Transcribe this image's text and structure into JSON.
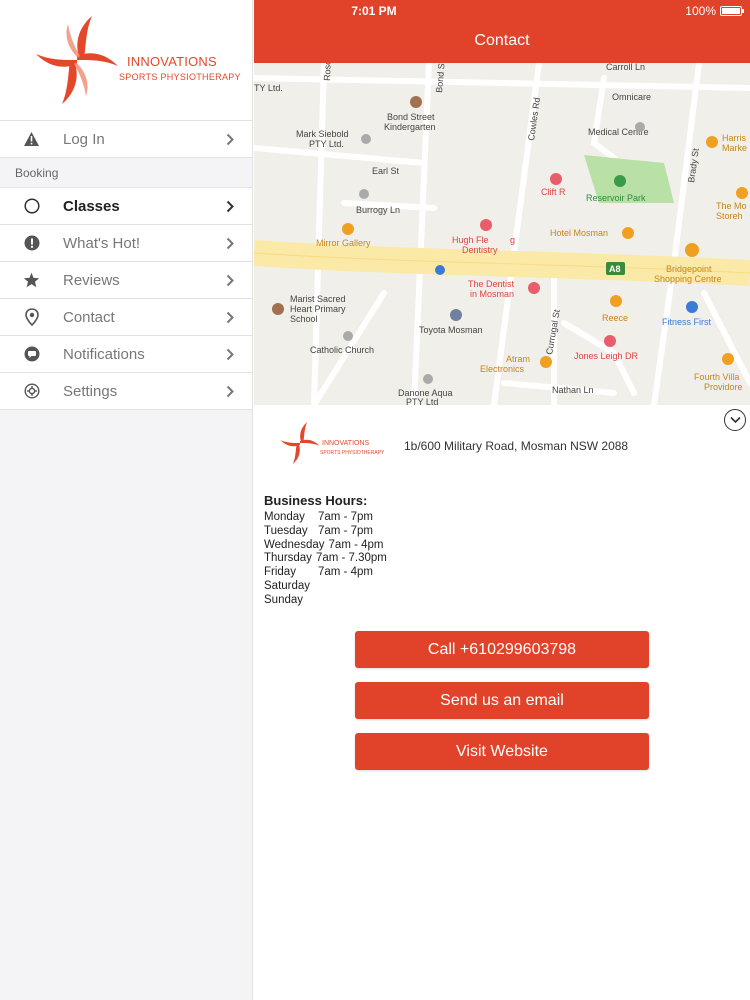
{
  "brand": {
    "name": "INNOVATIONS",
    "tagline": "SPORTS PHYSIOTHERAPY",
    "accent_color": "#e1432a"
  },
  "sidebar": {
    "items": [
      {
        "label": "Log In",
        "icon": "warning-icon"
      },
      {
        "label": "Classes",
        "icon": "circle-icon",
        "active": true
      },
      {
        "label": "What's Hot!",
        "icon": "exclamation-icon"
      },
      {
        "label": "Reviews",
        "icon": "star-icon"
      },
      {
        "label": "Contact",
        "icon": "location-pin-icon"
      },
      {
        "label": "Notifications",
        "icon": "chat-bubble-icon"
      },
      {
        "label": "Settings",
        "icon": "gear-icon"
      }
    ],
    "section_booking": "Booking"
  },
  "status": {
    "time": "7:01 PM",
    "battery": "100%"
  },
  "header": {
    "title": "Contact"
  },
  "map": {
    "labels": {
      "ptyltd": "TY Ltd.",
      "rose": "Rose",
      "bond": "Bond St",
      "bondkinder1": "Bond Street",
      "bondkinder2": "Kindergarten",
      "markseibold1": "Mark Siebold",
      "markseibold2": "PTY Ltd.",
      "cowles": "Cowles Rd",
      "omnicare1": "Omnicare",
      "omnicare2": "Medical Centre",
      "harris1": "Harris",
      "harris2": "Marke",
      "earl": "Earl St",
      "clift": "Clift R",
      "reservoir": "Reservoir Park",
      "brady": "Brady St",
      "themo1": "The Mo",
      "themo2": "Storeh",
      "burrogy": "Burrogy Ln",
      "hotel": "Hotel Mosman",
      "mirror": "Mirror Gallery",
      "hugh1": "Hugh Fle",
      "hugh2": "g",
      "hugh3": "Dentistry",
      "a8": "A8",
      "bridgepoint1": "Bridgepoint",
      "bridgepoint2": "Shopping Centre",
      "marist1": "Marist Sacred",
      "marist2": "Heart Primary",
      "marist3": "School",
      "dentist1": "The Dentist",
      "dentist2": "in Mosman",
      "reece": "Reece",
      "fitness": "Fitness First",
      "toyota": "Toyota Mosman",
      "currugal": "Currugal St",
      "catholic": "Catholic Church",
      "atram1": "Atram",
      "atram2": "Electronics",
      "jones": "Jones Leigh DR",
      "fourth1": "Fourth Villa",
      "fourth2": "Providore",
      "danone1": "Danone Aqua",
      "danone2": "PTY Ltd",
      "nathan": "Nathan Ln",
      "carroll": "Carroll Ln"
    }
  },
  "info": {
    "address": "1b/600 Military Road, Mosman NSW 2088",
    "hours_title": "Business Hours:",
    "hours": [
      {
        "day": "Monday",
        "time": "7am - 7pm"
      },
      {
        "day": "Tuesday",
        "time": "7am - 7pm"
      },
      {
        "day": "Wednesday",
        "time": "7am - 4pm"
      },
      {
        "day": "Thursday",
        "time": "7am - 7.30pm"
      },
      {
        "day": "Friday",
        "time": "7am - 4pm"
      },
      {
        "day": "Saturday",
        "time": ""
      },
      {
        "day": "Sunday",
        "time": ""
      }
    ],
    "buttons": {
      "call": "Call +610299603798",
      "email": "Send us an email",
      "website": "Visit Website"
    }
  }
}
